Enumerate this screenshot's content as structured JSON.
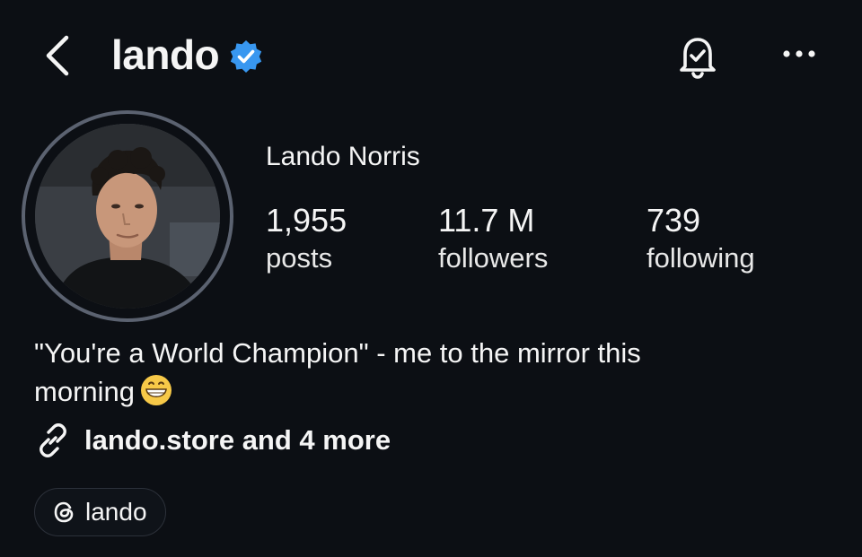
{
  "header": {
    "username": "lando",
    "icons": {
      "back": "chevron-left-icon",
      "verified": "verified-badge-icon",
      "notifications": "bell-check-icon",
      "more": "more-horizontal-icon"
    }
  },
  "profile": {
    "full_name": "Lando Norris",
    "stats": [
      {
        "value": "1,955",
        "label": "posts"
      },
      {
        "value": "11.7 M",
        "label": "followers"
      },
      {
        "value": "739",
        "label": "following"
      }
    ],
    "bio_line1": "\"You're a World Champion\" - me to the mirror this",
    "bio_line2": "morning",
    "link_text": "lando.store and 4 more",
    "threads_label": "lando"
  },
  "colors": {
    "background": "#0c0f14",
    "text": "#f5f5f5",
    "verified_blue": "#3897f0",
    "avatar_ring": "#5b6270"
  }
}
